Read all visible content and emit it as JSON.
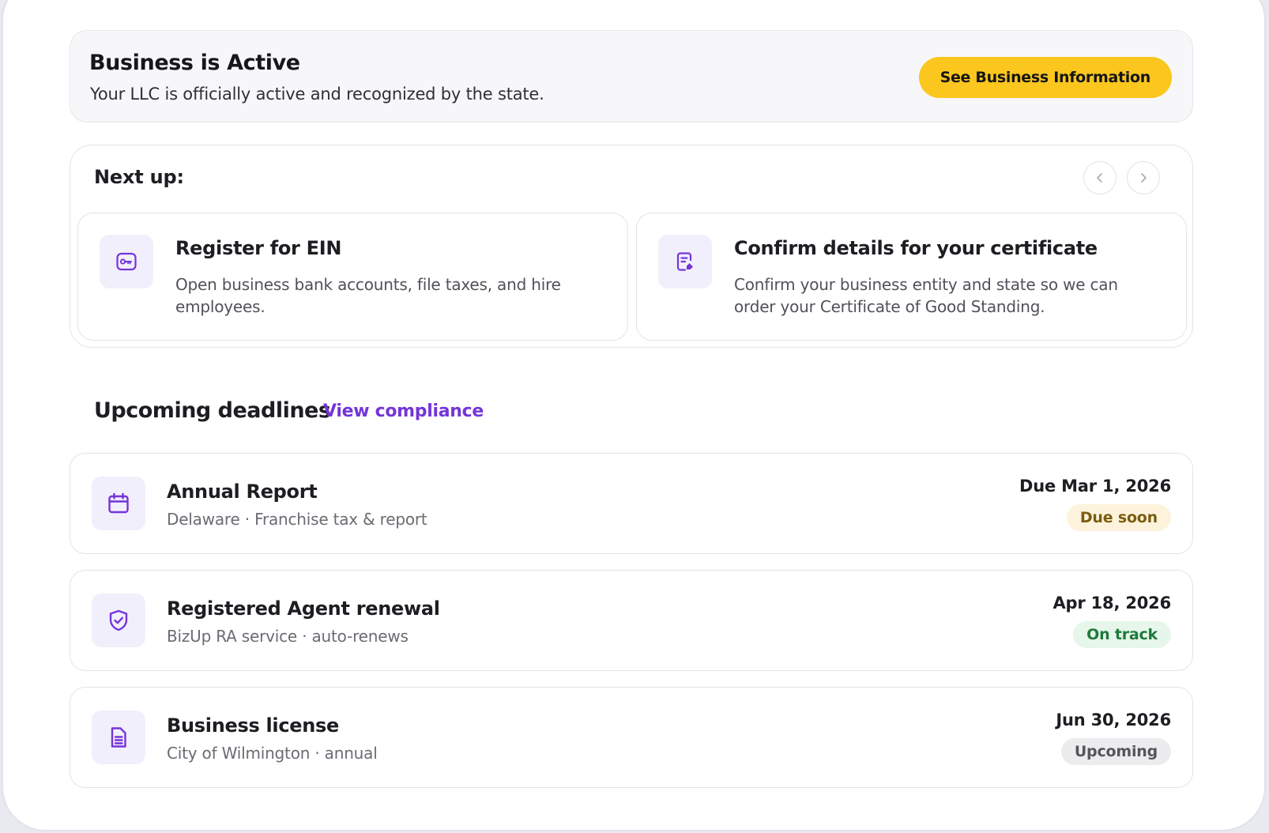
{
  "status": {
    "title": "Business is Active",
    "subtitle": "Your LLC is officially active and recognized by the state.",
    "cta_label": "See Business Information"
  },
  "next_up": {
    "title": "Next up:",
    "tasks": [
      {
        "icon": "key-icon",
        "title": "Register for EIN",
        "description": "Open business bank accounts, file taxes, and hire employees."
      },
      {
        "icon": "certificate-edit-icon",
        "title": "Confirm details for your certificate",
        "description": "Confirm your business entity and state so we can order your Certificate of Good Standing."
      }
    ]
  },
  "deadlines": {
    "title": "Upcoming deadlines",
    "link_label": "View compliance",
    "items": [
      {
        "icon": "calendar-icon",
        "title": "Annual Report",
        "subtitle": "Delaware · Franchise tax & report",
        "date": "Due Mar 1, 2026",
        "status": "Due soon"
      },
      {
        "icon": "shield-check-icon",
        "title": "Registered Agent renewal",
        "subtitle": "BizUp RA service · auto-renews",
        "date": "Apr 18, 2026",
        "status": "On track"
      },
      {
        "icon": "document-icon",
        "title": "Business license",
        "subtitle": "City of Wilmington · annual",
        "date": "Jun 30, 2026",
        "status": "Upcoming"
      }
    ]
  },
  "colors": {
    "accent": "#7435d8",
    "cta": "#fbc61e",
    "due_soon_bg": "#fdf3dc",
    "on_track_bg": "#e6f6ea",
    "upcoming_bg": "#ececef"
  }
}
